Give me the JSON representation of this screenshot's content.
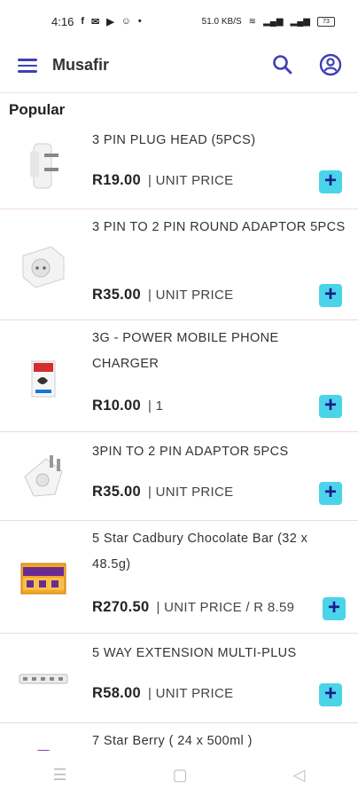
{
  "status_bar": {
    "time": "4:16",
    "data_speed": "51.0 KB/S",
    "battery": "73"
  },
  "app_bar": {
    "title": "Musafir",
    "accent_color": "#3f3fb5"
  },
  "section": {
    "title": "Popular"
  },
  "products": [
    {
      "name": "3 PIN PLUG HEAD (5PCS)",
      "price": "R19.00",
      "unit": "| UNIT PRICE"
    },
    {
      "name": "3 PIN TO 2 PIN ROUND ADAPTOR 5PCS",
      "price": "R35.00",
      "unit": "| UNIT PRICE"
    },
    {
      "name": "3G - POWER MOBILE PHONE CHARGER",
      "price": "R10.00",
      "unit": "| 1"
    },
    {
      "name": "3PIN TO 2 PIN ADAPTOR 5PCS",
      "price": "R35.00",
      "unit": "| UNIT PRICE"
    },
    {
      "name": "5 Star Cadbury Chocolate Bar (32 x 48.5g)",
      "price": "R270.50",
      "unit": "| UNIT PRICE / R 8.59"
    },
    {
      "name": "5 WAY EXTENSION MULTI-PLUS",
      "price": "R58.00",
      "unit": "| UNIT PRICE"
    },
    {
      "name": "7 Star Berry  ( 24 x 500ml )",
      "price": "",
      "unit": ""
    }
  ],
  "add_button_color": "#4ad4ea"
}
